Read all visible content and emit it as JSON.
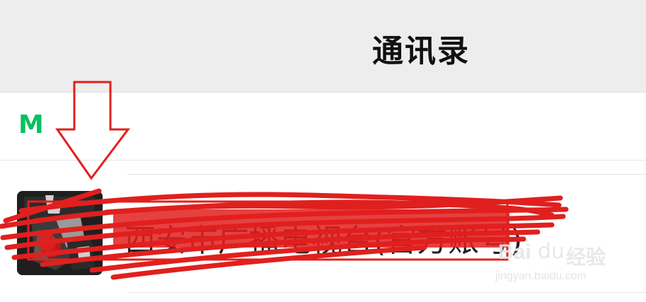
{
  "header": {
    "title": "通讯录"
  },
  "section": {
    "letter": "M"
  },
  "contacts": [
    {
      "name": "西安市广播电视台(官方账号)",
      "avatar_icon": "contact-avatar"
    }
  ],
  "annotation": {
    "arrow_icon": "down-arrow-icon",
    "color": "#e0201e"
  },
  "watermark": {
    "brand": "Bai",
    "paw": "du",
    "cn": "经验",
    "url": "jingyan.baidu.com"
  },
  "colors": {
    "accent": "#07c160",
    "header_bg": "#ededed",
    "annotation": "#e0201e"
  }
}
